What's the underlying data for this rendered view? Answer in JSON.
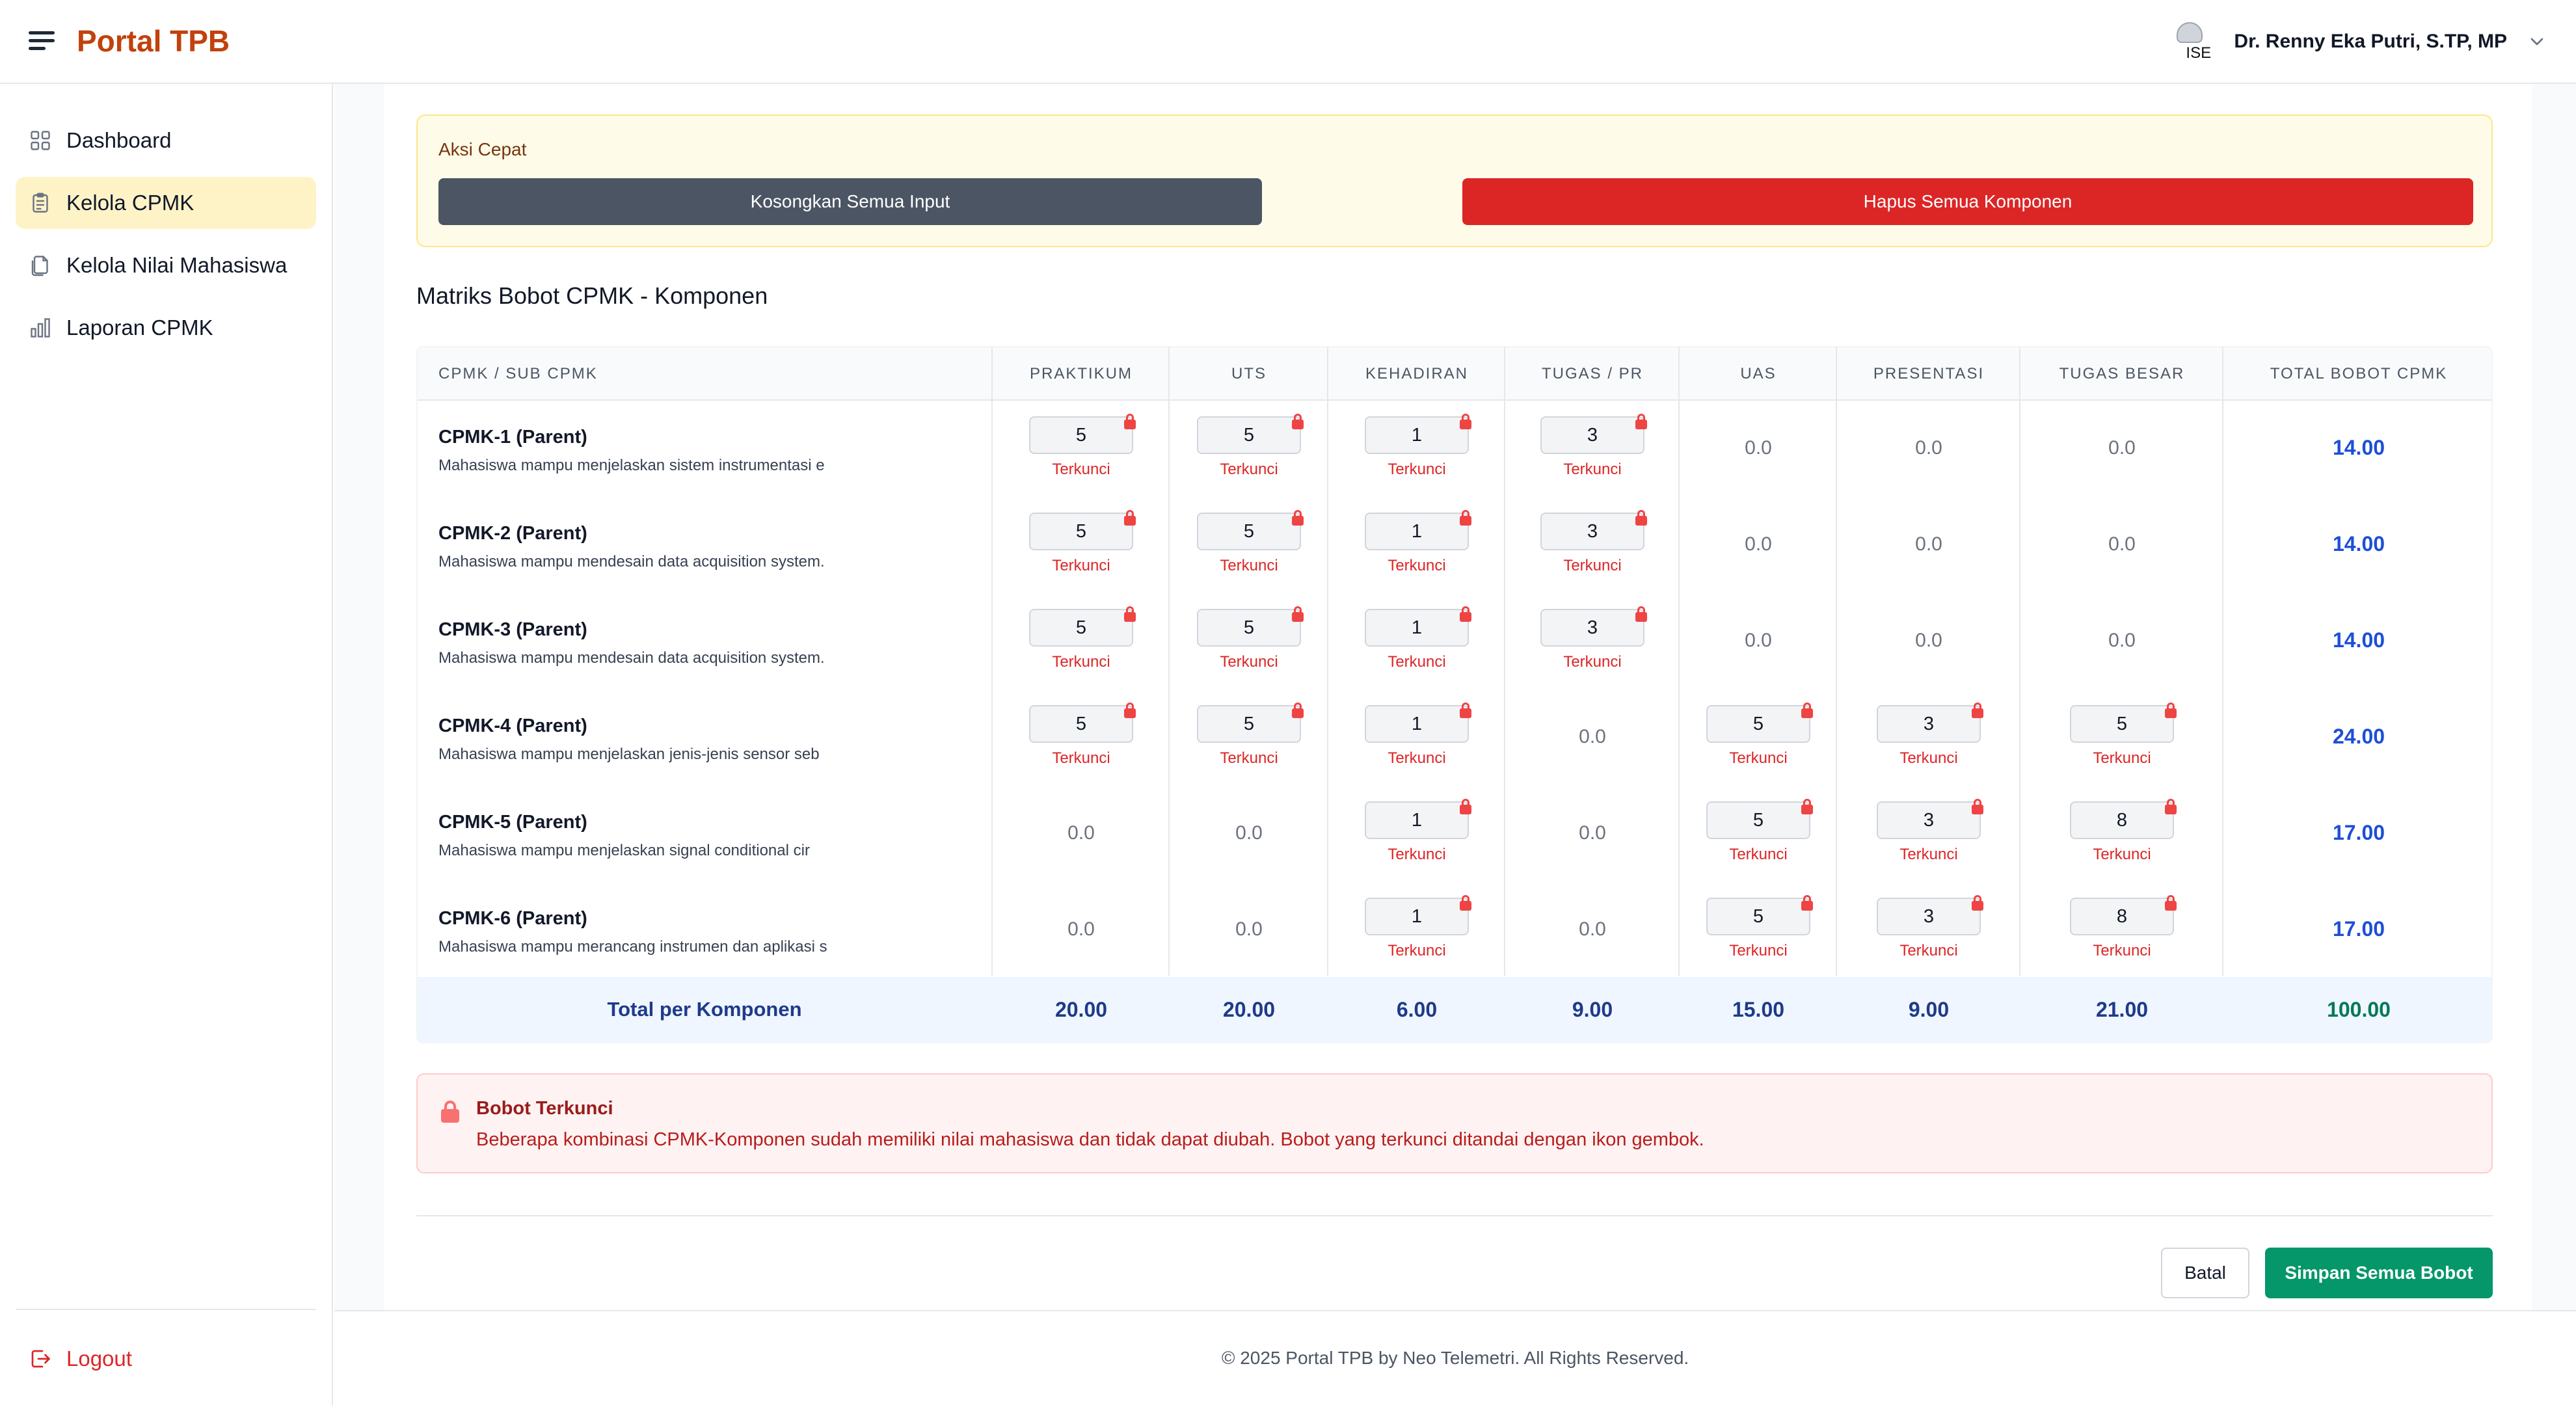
{
  "app": {
    "title": "Portal TPB"
  },
  "user": {
    "name": "Dr. Renny Eka Putri, S.TP, MP",
    "avatar_alt": "ISE"
  },
  "sidebar": {
    "items": [
      {
        "label": "Dashboard",
        "icon": "grid-icon",
        "active": false
      },
      {
        "label": "Kelola CPMK",
        "icon": "clipboard-icon",
        "active": true
      },
      {
        "label": "Kelola Nilai Mahasiswa",
        "icon": "documents-icon",
        "active": false
      },
      {
        "label": "Laporan CPMK",
        "icon": "bar-chart-icon",
        "active": false
      }
    ],
    "logout_label": "Logout"
  },
  "quick_actions": {
    "title": "Aksi Cepat",
    "clear_label": "Kosongkan Semua Input",
    "delete_label": "Hapus Semua Komponen"
  },
  "matrix": {
    "title": "Matriks Bobot CPMK - Komponen",
    "first_col_header": "CPMK / SUB CPMK",
    "columns": [
      "PRAKTIKUM",
      "UTS",
      "KEHADIRAN",
      "TUGAS / PR",
      "UAS",
      "PRESENTASI",
      "TUGAS BESAR"
    ],
    "total_col_header": "TOTAL BOBOT CPMK",
    "locked_label": "Terkunci",
    "rows": [
      {
        "name": "CPMK-1 (Parent)",
        "desc": "Mahasiswa mampu menjelaskan sistem instrumentasi e",
        "cells": [
          {
            "v": "5",
            "locked": true
          },
          {
            "v": "5",
            "locked": true
          },
          {
            "v": "1",
            "locked": true
          },
          {
            "v": "3",
            "locked": true
          },
          {
            "v": "0.0",
            "locked": false
          },
          {
            "v": "0.0",
            "locked": false
          },
          {
            "v": "0.0",
            "locked": false
          }
        ],
        "total": "14.00"
      },
      {
        "name": "CPMK-2 (Parent)",
        "desc": "Mahasiswa mampu mendesain data acquisition system.",
        "cells": [
          {
            "v": "5",
            "locked": true
          },
          {
            "v": "5",
            "locked": true
          },
          {
            "v": "1",
            "locked": true
          },
          {
            "v": "3",
            "locked": true
          },
          {
            "v": "0.0",
            "locked": false
          },
          {
            "v": "0.0",
            "locked": false
          },
          {
            "v": "0.0",
            "locked": false
          }
        ],
        "total": "14.00"
      },
      {
        "name": "CPMK-3 (Parent)",
        "desc": "Mahasiswa mampu mendesain data acquisition system.",
        "cells": [
          {
            "v": "5",
            "locked": true
          },
          {
            "v": "5",
            "locked": true
          },
          {
            "v": "1",
            "locked": true
          },
          {
            "v": "3",
            "locked": true
          },
          {
            "v": "0.0",
            "locked": false
          },
          {
            "v": "0.0",
            "locked": false
          },
          {
            "v": "0.0",
            "locked": false
          }
        ],
        "total": "14.00"
      },
      {
        "name": "CPMK-4 (Parent)",
        "desc": "Mahasiswa mampu menjelaskan jenis-jenis sensor seb",
        "cells": [
          {
            "v": "5",
            "locked": true
          },
          {
            "v": "5",
            "locked": true
          },
          {
            "v": "1",
            "locked": true
          },
          {
            "v": "0.0",
            "locked": false
          },
          {
            "v": "5",
            "locked": true
          },
          {
            "v": "3",
            "locked": true
          },
          {
            "v": "5",
            "locked": true
          }
        ],
        "total": "24.00"
      },
      {
        "name": "CPMK-5 (Parent)",
        "desc": "Mahasiswa mampu menjelaskan signal conditional cir",
        "cells": [
          {
            "v": "0.0",
            "locked": false
          },
          {
            "v": "0.0",
            "locked": false
          },
          {
            "v": "1",
            "locked": true
          },
          {
            "v": "0.0",
            "locked": false
          },
          {
            "v": "5",
            "locked": true
          },
          {
            "v": "3",
            "locked": true
          },
          {
            "v": "8",
            "locked": true
          }
        ],
        "total": "17.00"
      },
      {
        "name": "CPMK-6 (Parent)",
        "desc": "Mahasiswa mampu merancang instrumen dan aplikasi s",
        "cells": [
          {
            "v": "0.0",
            "locked": false
          },
          {
            "v": "0.0",
            "locked": false
          },
          {
            "v": "1",
            "locked": true
          },
          {
            "v": "0.0",
            "locked": false
          },
          {
            "v": "5",
            "locked": true
          },
          {
            "v": "3",
            "locked": true
          },
          {
            "v": "8",
            "locked": true
          }
        ],
        "total": "17.00"
      }
    ],
    "footer_label": "Total per Komponen",
    "footer_totals": [
      "20.00",
      "20.00",
      "6.00",
      "9.00",
      "15.00",
      "9.00",
      "21.00"
    ],
    "grand_total": "100.00"
  },
  "alert": {
    "title": "Bobot Terkunci",
    "text": "Beberapa kombinasi CPMK-Komponen sudah memiliki nilai mahasiswa dan tidak dapat diubah. Bobot yang terkunci ditandai dengan ikon gembok."
  },
  "actions": {
    "cancel_label": "Batal",
    "save_label": "Simpan Semua Bobot"
  },
  "footer": {
    "text": "© 2025 Portal TPB by Neo Telemetri. All Rights Reserved."
  },
  "colors": {
    "brand": "#c2410c",
    "active_nav": "#fef3c7",
    "danger": "#dc2626",
    "success": "#059669",
    "total_blue": "#1d4ed8"
  }
}
